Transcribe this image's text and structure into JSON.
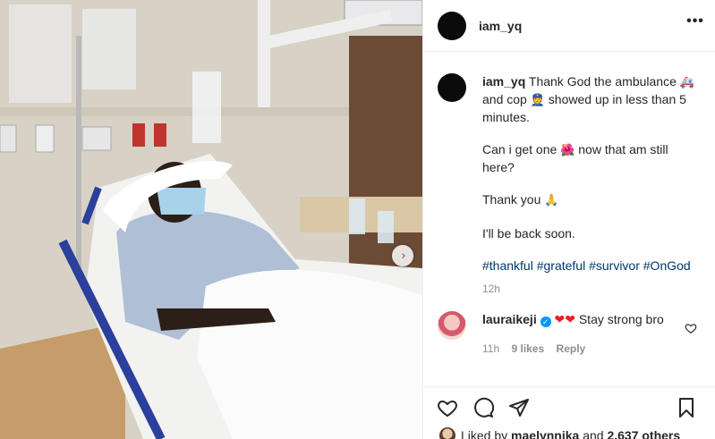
{
  "post": {
    "username": "iam_yq",
    "more_label": "•••",
    "caption": {
      "username": "iam_yq",
      "line1_a": "Thank God the ambulance",
      "line1_emoji_ambulance": "🚑",
      "line1_b": "and cop",
      "line1_emoji_cop": "👮",
      "line1_c": "showed up in less than 5 minutes.",
      "line2_a": "Can i get one",
      "line2_emoji_flower": "🌺",
      "line2_b": "now that am still here?",
      "line3_a": "Thank you",
      "line3_emoji_pray": "🙏",
      "line4": "I'll be back soon.",
      "hashtags": "#thankful #grateful #survivor #OnGod",
      "time": "12h"
    },
    "comment": {
      "username": "lauraikeji",
      "verified_mark": "✓",
      "hearts": "❤❤",
      "text": "Stay strong bro",
      "time": "11h",
      "likes": "9 likes",
      "reply": "Reply"
    },
    "likes_line": {
      "prefix": "Liked by",
      "user": "maelynnika",
      "middle": "and",
      "others": "2,637 others"
    },
    "next_arrow": "›"
  },
  "colors": {
    "link": "#00376b",
    "muted": "#8e8e8e",
    "heart": "#ed1c24",
    "verified": "#0095f6"
  }
}
